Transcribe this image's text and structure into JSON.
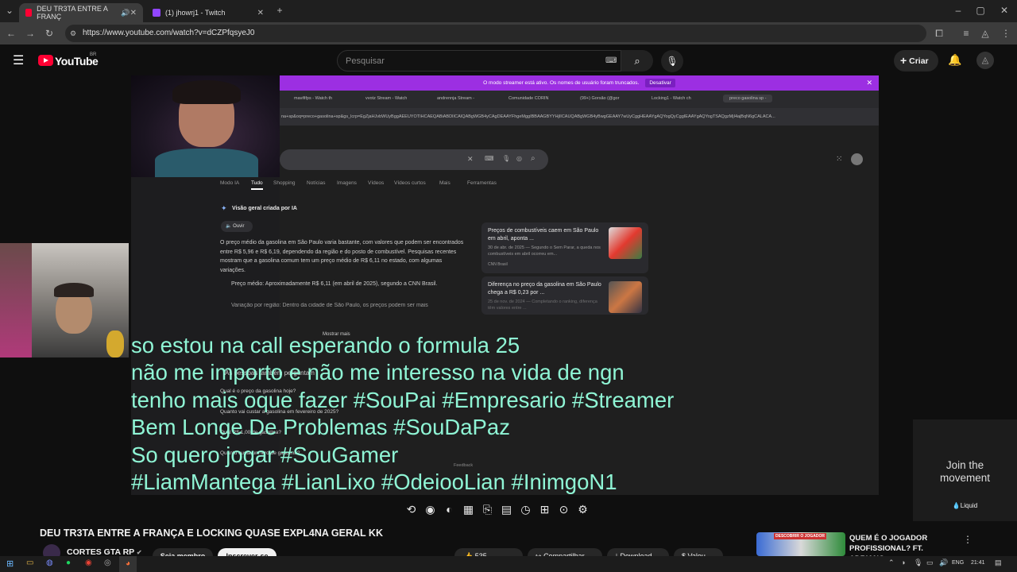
{
  "browser": {
    "tabs": [
      {
        "title": "DEU TR3TA ENTRE A FRANÇ",
        "active": true
      },
      {
        "title": "(1) jhowrj1 - Twitch",
        "active": false
      }
    ],
    "url": "https://www.youtube.com/watch?v=dCZPfqsyeJ0"
  },
  "youtube": {
    "logo_text": "YouTube",
    "region": "BR",
    "search_placeholder": "Pesquisar",
    "create_label": "Criar"
  },
  "inner_stream": {
    "streamer_notice": "O modo streamer está ativo. Os nomes de usuário foram truncados.",
    "deactivate_label": "Desativar",
    "tabs": [
      "mavififps - Watch th",
      "vvotz Stream - Watch",
      "andrennja Stream - ",
      "Comunidade CORIN",
      "(99+) Gorsão (@gor",
      "Locking1 - Watch ch",
      "preco gasolina sp - "
    ],
    "url_text": "na+sp&oq=preco+gasolina+sp&gs_lcrp=EgZjaHJvbWUyBggAEEUYOTIHCAEQABiABDIICAIQABgWGB4yCAgDEAAYFhgeMggIBBAAGBYYHjIICAUQABgWGB4yBwgGEAAY7wUyCggHEAAYgAQYogQyCggIEAAYgAQYogTSAQgzMjI4ajBqN6gCALACA...",
    "search_tabs": [
      "Modo IA",
      "Tudo",
      "Shopping",
      "Notícias",
      "Imagens",
      "Vídeos",
      "Vídeos curtos",
      "Mais",
      "Ferramentas"
    ],
    "ai_overview_title": "Visão geral criada por IA",
    "listen_label": "Ouvir",
    "ai_text": "O preço médio da gasolina em São Paulo varia bastante, com valores que podem ser encontrados entre R$ 5,96 e R$ 6,19, dependendo da região e do posto de combustível. Pesquisas recentes mostram que a gasolina comum tem um preço médio de R$ 6,11 no estado, com algumas variações.",
    "bullet1": "Preço médio: Aproximadamente R$ 6,11 (em abril de 2025), segundo a CNN Brasil.",
    "bullet2": "Variação por região: Dentro da cidade de São Paulo, os preços podem ser mais",
    "show_more": "Mostrar mais",
    "people_also_ask": "As pessoas também perguntam",
    "questions": [
      "Qual é o preço da gasolina hoje?",
      "Quanto vai custar a gasolina em fevereiro de 2025?",
      "Qual R$ 1,00 de gasolina?",
      "Quanto custa um litro de gasolina?"
    ],
    "feedback": "Feedback",
    "card1": {
      "title": "Preços de combustíveis caem em São Paulo em abril, aponta ...",
      "desc": "30 de abr. de 2025 — Segundo o Sem Parar, a queda nos combustíveis em abril ocorreu em...",
      "source": "CNN Brasil"
    },
    "card2": {
      "title": "Diferença no preço da gasolina em São Paulo chega a R$ 0,23 por ...",
      "desc": "25 de nov. de 2024 — Completando o ranking, diferença têm valores entre ..."
    }
  },
  "captions": [
    "so estou na call esperando o formula 25",
    "não me importo e não me interesso na vida de ngn",
    "tenho mais oque fazer #SouPai #Empresario #Streamer",
    "Bem Longe De Problemas #SouDaPaz",
    "So quero jogar #SouGamer",
    "#LiamMantega #LianLixo #OdeiooLian #InimgoN1"
  ],
  "ad": {
    "headline": "Join the movement",
    "brand": "Liquid"
  },
  "video": {
    "title": "DEU TR3TA ENTRE A FRANÇA E LOCKING QUASE EXPL4NA GERAL KK",
    "channel": "CORTES GTA RP",
    "join_label": "Seja membro",
    "subscribe_label": "Inscrever-se",
    "likes": "535",
    "share_label": "Compartilhar",
    "download_label": "Download",
    "thanks_label": "Valeu"
  },
  "suggestion": {
    "title": "QUEM É O JOGADOR PROFISSIONAL? FT. ADRIANO...",
    "thumb_text": "DESCOBRIR O JOGADOR"
  },
  "taskbar": {
    "lang": "ENG",
    "time": "21:41"
  },
  "colors": {
    "accent_purple": "#9c2fe2",
    "caption": "#8ff5d5",
    "youtube_red": "#ff0033"
  }
}
